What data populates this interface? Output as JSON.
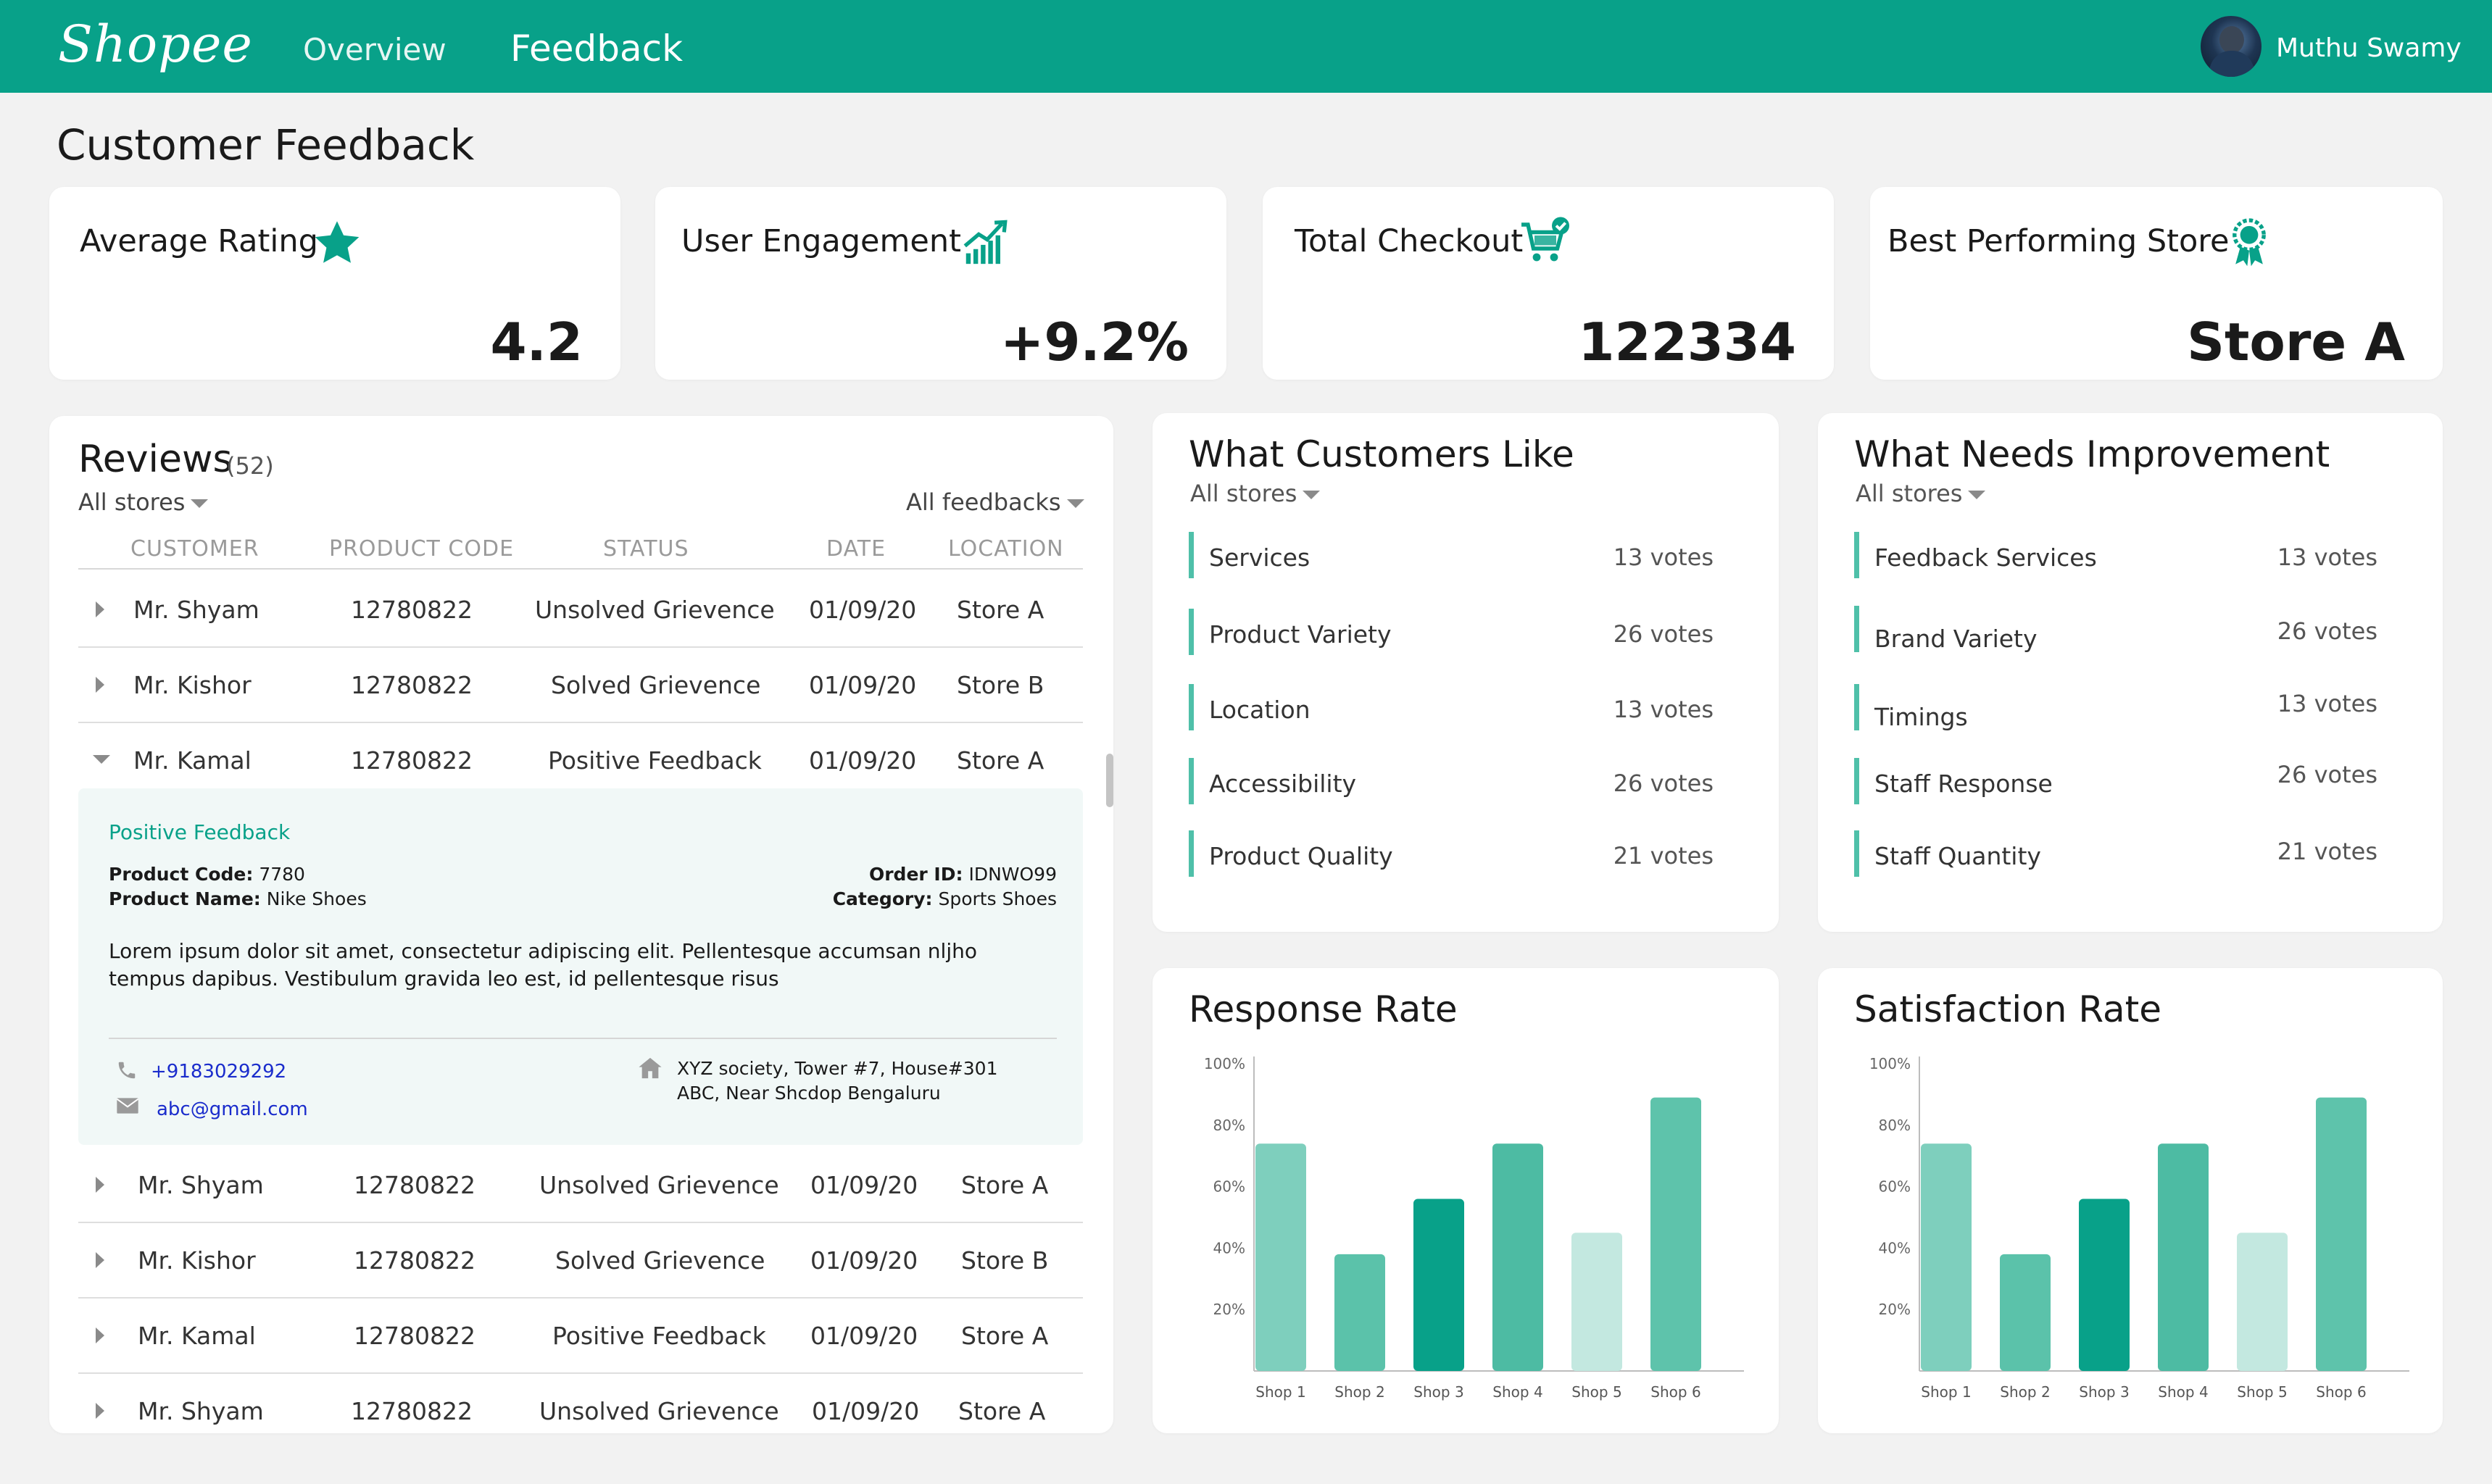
{
  "header": {
    "logo": "Shopee",
    "nav": {
      "overview": "Overview",
      "feedback": "Feedback"
    },
    "user": {
      "name": "Muthu Swamy",
      "avatar_icon": "user-avatar"
    },
    "color": "#08a189"
  },
  "page": {
    "title": "Customer Feedback"
  },
  "kpis": {
    "rating": {
      "label": "Average Rating",
      "value": "4.2",
      "icon": "star-icon"
    },
    "engagement": {
      "label": "User Engagement",
      "value": "+9.2%",
      "icon": "growth-chart-icon"
    },
    "checkout": {
      "label": "Total Checkout",
      "value": "122334",
      "icon": "cart-check-icon"
    },
    "store": {
      "label": "Best Performing Store",
      "value": "Store A",
      "icon": "award-badge-icon"
    }
  },
  "reviews": {
    "title": "Reviews",
    "count": "(52)",
    "store_filter": "All stores",
    "feedback_filter": "All feedbacks",
    "columns": {
      "customer": "CUSTOMER",
      "product": "PRODUCT CODE",
      "status": "STATUS",
      "date": "DATE",
      "location": "LOCATION"
    },
    "rows": [
      {
        "customer": "Mr. Shyam",
        "product": "12780822",
        "status": "Unsolved Grievence",
        "date": "01/09/20",
        "location": "Store A"
      },
      {
        "customer": "Mr. Kishor",
        "product": "12780822",
        "status": "Solved Grievence",
        "date": "01/09/20",
        "location": "Store B"
      },
      {
        "customer": "Mr. Kamal",
        "product": "12780822",
        "status": "Positive Feedback",
        "date": "01/09/20",
        "location": "Store A"
      },
      {
        "customer": "Mr. Shyam",
        "product": "12780822",
        "status": "Unsolved Grievence",
        "date": "01/09/20",
        "location": "Store A"
      },
      {
        "customer": "Mr. Kishor",
        "product": "12780822",
        "status": "Solved Grievence",
        "date": "01/09/20",
        "location": "Store B"
      },
      {
        "customer": "Mr. Kamal",
        "product": "12780822",
        "status": "Positive Feedback",
        "date": "01/09/20",
        "location": "Store A"
      },
      {
        "customer": "Mr. Shyam",
        "product": "12780822",
        "status": "Unsolved Grievence",
        "date": "01/09/20",
        "location": "Store A"
      }
    ],
    "detail": {
      "heading": "Positive Feedback",
      "product_code_label": "Product Code:",
      "product_code": "7780",
      "product_name_label": "Product Name:",
      "product_name": "Nike Shoes",
      "order_id_label": "Order ID:",
      "order_id": "IDNWO99",
      "category_label": "Category:",
      "category": "Sports Shoes",
      "comment": "Lorem ipsum dolor sit amet, consectetur adipiscing elit. Pellentesque accumsan nljho tempus dapibus. Vestibulum gravida leo est, id pellentesque risus",
      "phone": "+9183029292",
      "email": "abc@gmail.com",
      "address_line1": "XYZ society, Tower #7, House#301",
      "address_line2": "ABC, Near Shcdop Bengaluru"
    }
  },
  "likes": {
    "title": "What Customers Like",
    "filter": "All stores",
    "items": [
      {
        "name": "Services",
        "votes": "13 votes"
      },
      {
        "name": "Product Variety",
        "votes": "26 votes"
      },
      {
        "name": "Location",
        "votes": "13 votes"
      },
      {
        "name": "Accessibility",
        "votes": "26 votes"
      },
      {
        "name": "Product Quality",
        "votes": "21 votes"
      }
    ]
  },
  "improvements": {
    "title": "What Needs Improvement",
    "filter": "All stores",
    "items": [
      {
        "name": "Feedback Services",
        "votes": "13 votes"
      },
      {
        "name": "Brand Variety",
        "votes": "26 votes"
      },
      {
        "name": "Timings",
        "votes": "13 votes"
      },
      {
        "name": "Staff Response",
        "votes": "26 votes"
      },
      {
        "name": "Staff Quantity",
        "votes": "21 votes"
      }
    ]
  },
  "chart_data": [
    {
      "type": "bar",
      "title": "Response Rate",
      "categories": [
        "Shop 1",
        "Shop 2",
        "Shop 3",
        "Shop 4",
        "Shop 5",
        "Shop 6"
      ],
      "values": [
        74,
        38,
        56,
        74,
        45,
        89
      ],
      "yticks": [
        "100%",
        "80%",
        "60%",
        "40%",
        "20%"
      ],
      "ylim": [
        0,
        100
      ],
      "colors": [
        "#7ecfbd",
        "#5bc2aa",
        "#08a189",
        "#4dbba3",
        "#c3e8e0",
        "#5ec3ab"
      ]
    },
    {
      "type": "bar",
      "title": "Satisfaction Rate",
      "categories": [
        "Shop 1",
        "Shop 2",
        "Shop 3",
        "Shop 4",
        "Shop 5",
        "Shop 6"
      ],
      "values": [
        74,
        38,
        56,
        74,
        45,
        89
      ],
      "yticks": [
        "100%",
        "80%",
        "60%",
        "40%",
        "20%"
      ],
      "ylim": [
        0,
        100
      ],
      "colors": [
        "#7ecfbd",
        "#5bc2aa",
        "#08a189",
        "#4dbba3",
        "#c3e8e0",
        "#5ec3ab"
      ]
    }
  ]
}
